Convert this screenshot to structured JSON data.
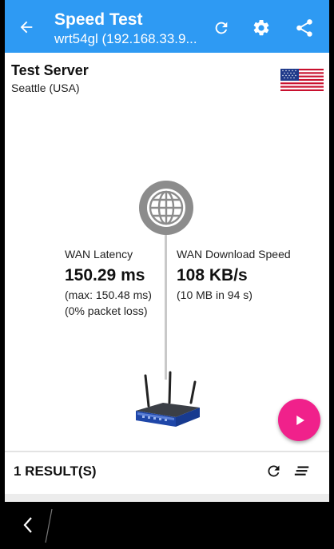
{
  "app_bar": {
    "title": "Speed Test",
    "subtitle": "wrt54gl (192.168.33.9...",
    "color": "#2e9af3"
  },
  "icons": {
    "back": "arrow-left-icon",
    "refresh": "refresh-icon",
    "settings": "gear-icon",
    "share": "share-icon",
    "globe": "globe-icon",
    "router": "router-icon",
    "play": "play-icon",
    "sort": "sort-icon",
    "nav_back": "chevron-left-icon"
  },
  "server": {
    "title": "Test Server",
    "location": "Seattle (USA)"
  },
  "latency": {
    "label": "WAN Latency",
    "value": "150.29 ms",
    "max": "(max: 150.48 ms)",
    "loss": "(0% packet loss)"
  },
  "download": {
    "label": "WAN Download Speed",
    "value": "108 KB/s",
    "detail": "(10 MB in 94 s)"
  },
  "fab": {
    "color": "#f0218b"
  },
  "results": {
    "label": "1 RESULT(S)"
  }
}
